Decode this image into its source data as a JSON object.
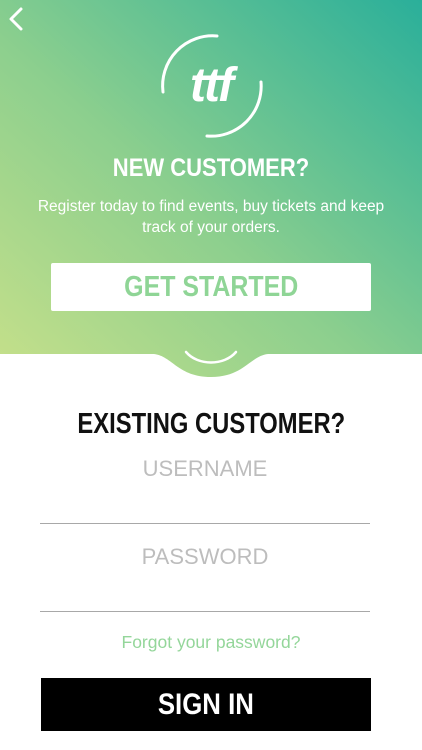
{
  "colors": {
    "gradient_start": "#c6e08a",
    "gradient_mid": "#8ccf8e",
    "gradient_end": "#2aaf9a",
    "accent_text": "#8fd596",
    "sign_in_bg": "#000000"
  },
  "header": {
    "back_icon": "chevron-left-icon"
  },
  "logo": {
    "text": "ttf"
  },
  "new_customer": {
    "title": "NEW CUSTOMER?",
    "subtitle": "Register today to find events, buy tickets and keep track of your orders.",
    "cta_label": "GET STARTED"
  },
  "existing_customer": {
    "title": "EXISTING CUSTOMER?",
    "username_placeholder": "USERNAME",
    "password_placeholder": "PASSWORD",
    "forgot_label": "Forgot your password?",
    "sign_in_label": "SIGN IN"
  }
}
